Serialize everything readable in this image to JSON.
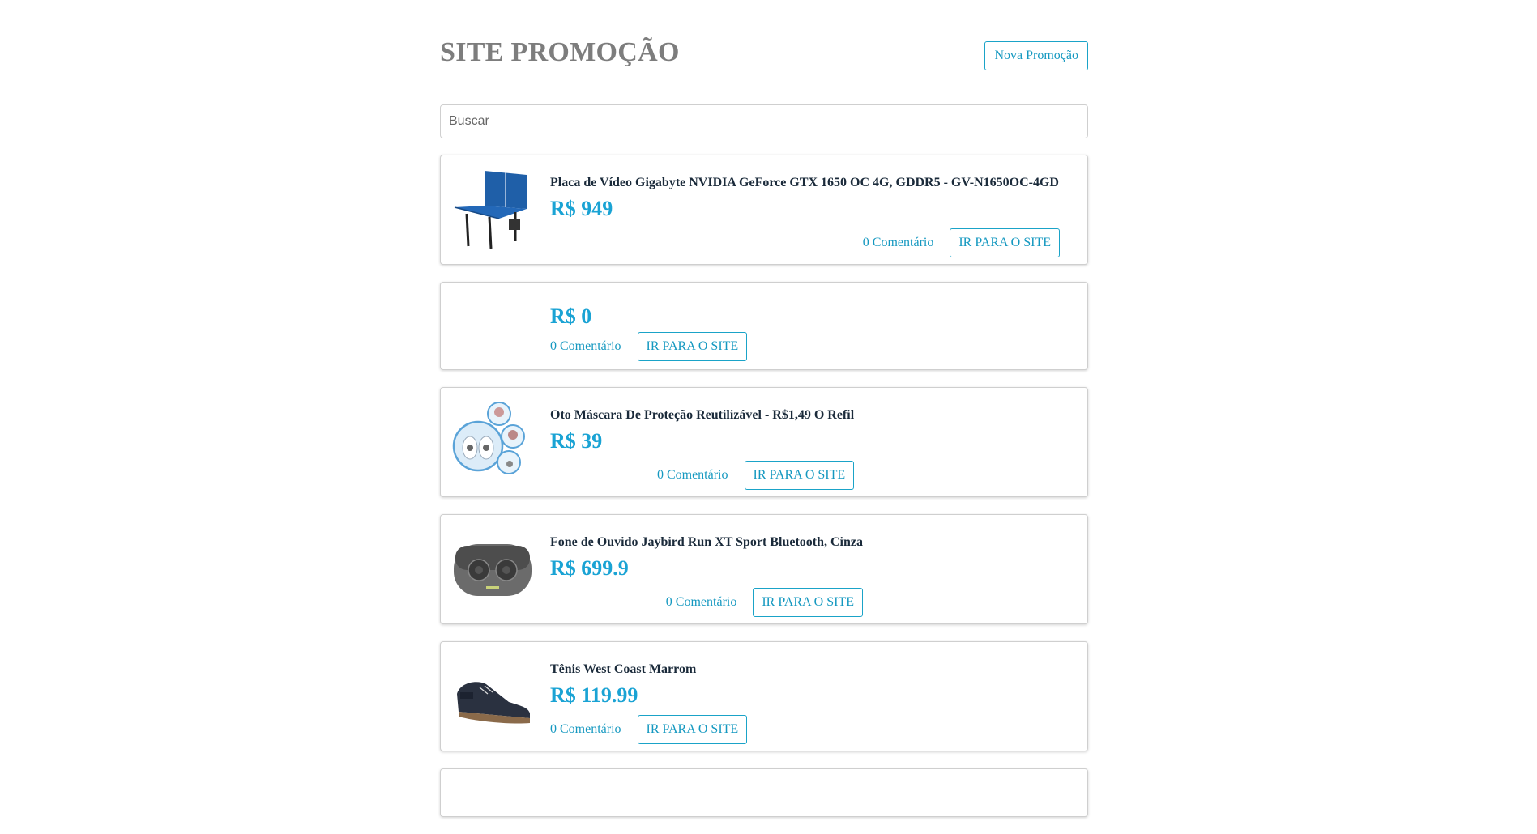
{
  "header": {
    "title": "SITE PROMOÇÃO",
    "new_promo_label": "Nova Promoção"
  },
  "search": {
    "placeholder": "Buscar"
  },
  "promotions": [
    {
      "title": "Placa de Vídeo Gigabyte NVIDIA GeForce GTX 1650 OC 4G, GDDR5 - GV-N1650OC-4GD",
      "price": "R$ 949",
      "comments": "0 Comentário",
      "link_label": "IR PARA O SITE",
      "image_icon": "ping-pong-table-icon"
    },
    {
      "title": "",
      "price": "R$ 0",
      "comments": "0 Comentário",
      "link_label": "IR PARA O SITE",
      "image_icon": ""
    },
    {
      "title": "Oto Máscara De Proteção Reutilizável - R$1,49 O Refil",
      "price": "R$ 39",
      "comments": "0 Comentário",
      "link_label": "IR PARA O SITE",
      "image_icon": "mask-icon"
    },
    {
      "title": "Fone de Ouvido Jaybird Run XT Sport Bluetooth, Cinza",
      "price": "R$ 699.9",
      "comments": "0 Comentário",
      "link_label": "IR PARA O SITE",
      "image_icon": "earbuds-case-icon"
    },
    {
      "title": "Tênis West Coast Marrom",
      "price": "R$ 119.99",
      "comments": "0 Comentário",
      "link_label": "IR PARA O SITE",
      "image_icon": "shoe-icon"
    }
  ],
  "colors": {
    "accent": "#1aa3c8",
    "price": "#1aa3d4",
    "title_gray": "#7d7d7d"
  }
}
